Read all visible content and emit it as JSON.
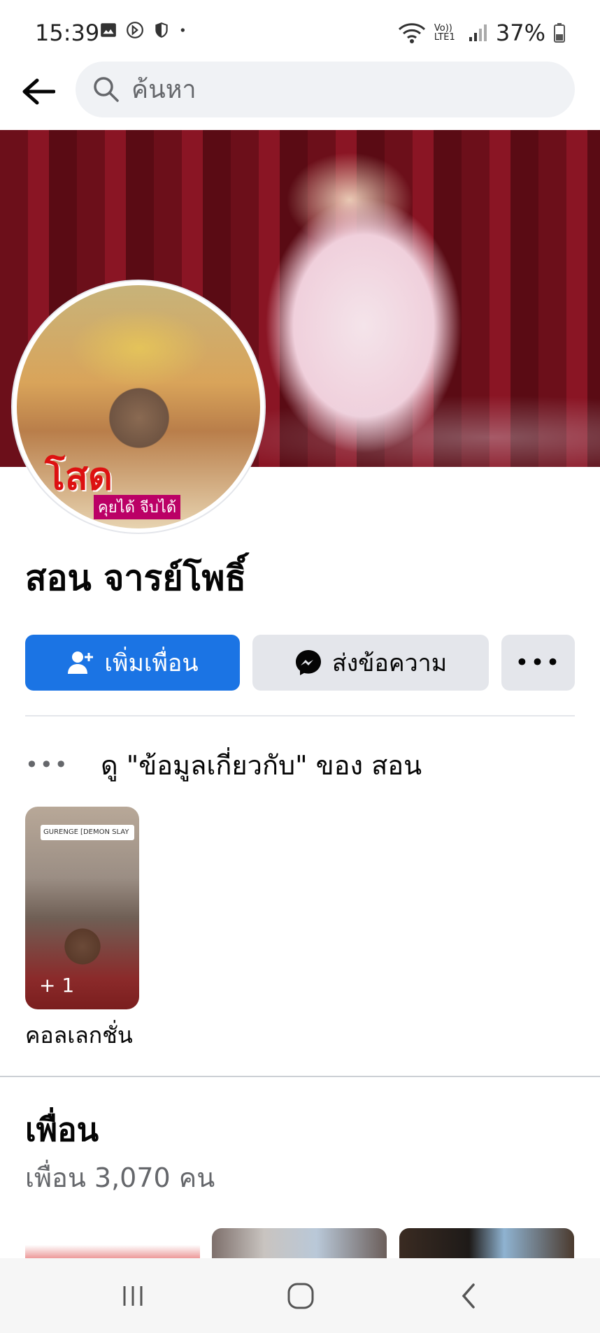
{
  "status_bar": {
    "time": "15:39",
    "battery": "37%",
    "icons": [
      "image-icon",
      "no-disturb-icon",
      "shield-icon",
      "dot-icon",
      "wifi-icon",
      "volte-icon",
      "signal-icon",
      "battery-icon"
    ],
    "volte_label": "Vo)) LTE1"
  },
  "search": {
    "placeholder": "ค้นหา"
  },
  "profile": {
    "name": "สอน จารย์โพธิ์",
    "avatar_text": "โสด",
    "avatar_subtext": "คุยได้ จีบได้"
  },
  "actions": {
    "add_friend": "เพิ่มเพื่อน",
    "message": "ส่งข้อความ",
    "more": "•••"
  },
  "about": {
    "dots": "•••",
    "text": "ดู \"ข้อมูลเกี่ยวกับ\" ของ สอน"
  },
  "collections": {
    "thumb_tag": "GURENGE [DEMON SLAY",
    "count": "+ 1",
    "label": "คอลเลกชั่น"
  },
  "friends": {
    "title": "เพื่อน",
    "count": "เพื่อน 3,070 คน"
  },
  "colors": {
    "primary_button": "#1b74e4",
    "secondary_button": "#e4e6eb",
    "muted_text": "#65676b"
  }
}
